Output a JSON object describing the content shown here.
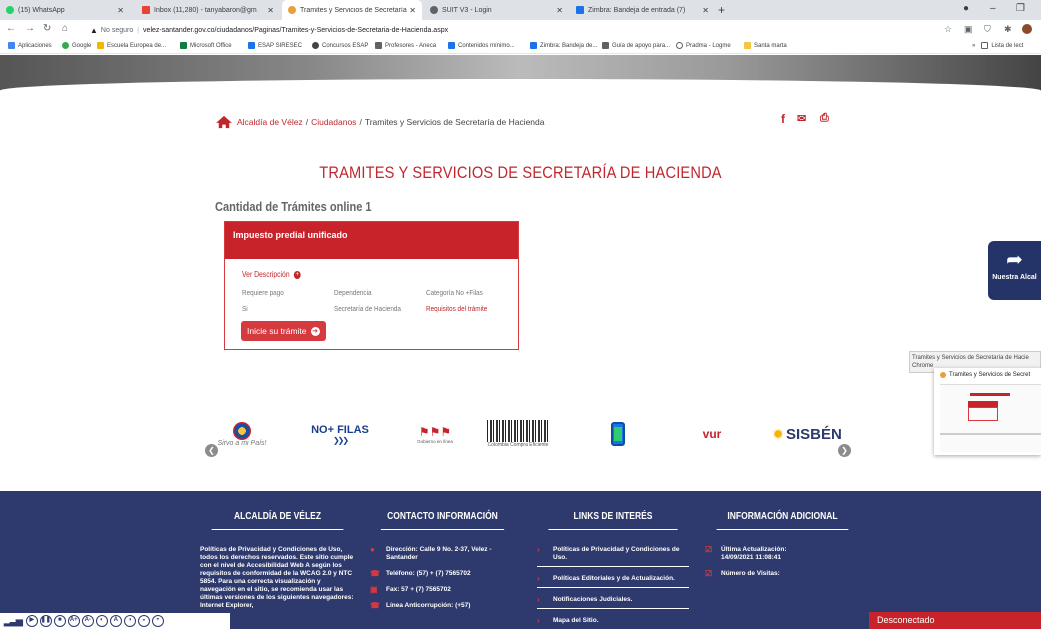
{
  "browser": {
    "tabs": [
      {
        "label": "(15) WhatsApp",
        "color": "#25d366"
      },
      {
        "label": "Inbox (11,280) - tanyabaron@gm",
        "color": "#ea4335"
      },
      {
        "label": "Tramites y Servicios de Secretaría",
        "color": "#e8a13a"
      },
      {
        "label": "SUIT V3 - Login",
        "color": "#5f6368"
      },
      {
        "label": "Zimbra: Bandeja de entrada (7)",
        "color": "#1a73e8"
      }
    ],
    "not_secure": "No seguro",
    "url": "velez-santander.gov.co/ciudadanos/Paginas/Tramites-y-Servicios-de-Secretaria-de-Hacienda.aspx",
    "bookmarks": [
      "Aplicaciones",
      "Google",
      "Escuela Europea de...",
      "Microsoft Office",
      "ESAP SIRESEC",
      "Concursos ESAP",
      "Profesores - Aneca",
      "Contenidos mínimo...",
      "Zimbra: Bandeja de...",
      "Guía de apoyo para...",
      "Pradma - Logme",
      "Santa marta"
    ],
    "reading_list": "Lista de lect"
  },
  "breadcrumb": {
    "home": "Alcaldía de Vélez",
    "sep1": "/",
    "section": "Ciudadanos",
    "sep2": "/",
    "current": "Tramites y Servicios de Secretaría de Hacienda"
  },
  "page_title": "TRAMITES Y SERVICIOS DE SECRETARÍA DE HACIENDA",
  "count_label": "Cantidad de Trámites online 1",
  "card": {
    "title": "Impuesto predial unificado",
    "desc_link": "Ver Descripción",
    "requires_label": "Requiere pago",
    "requires_value": "Si",
    "dependency_label": "Dependencia",
    "dependency_value": "Secretaría de Hacienda",
    "category_label": "Categoría No +Filas",
    "requirements_link": "Requisitos del trámite",
    "start_button": "Inicie su trámite"
  },
  "side_button": "Nuestra Alcal",
  "tooltip": {
    "line1": "Tramites y Servicios de Secretaría de Hacie",
    "line2": "Chrome"
  },
  "preview_title": "Tramites y Servicios de Secret",
  "logos": [
    {
      "label": "Sirvo a mi País!"
    },
    {
      "label": "NO+ FILAS"
    },
    {
      "label": "Gobierno en línea"
    },
    {
      "label": "Colombia Compra Eficiente"
    },
    {
      "label": ""
    },
    {
      "label": "vur"
    },
    {
      "label": "SISBÉN"
    }
  ],
  "footer": {
    "col1": {
      "title": "ALCALDÍA DE VÉLEZ",
      "text": "Políticas de Privacidad y Condiciones de Uso, todos los derechos reservados. Este sitio cumple con el nivel de Accesibilidad Web A según los requisitos de conformidad de la WCAG 2.0 y NTC 5854. Para una correcta visualización y navegación en el sitio, se recomienda usar las últimas versiones de los siguientes navegadores: Internet Explorer,"
    },
    "col2": {
      "title": "CONTACTO INFORMACIÓN",
      "items": [
        "Dirección: Calle 9 No. 2-37, Velez - Santander",
        "Teléfono: (57) + (7) 7565702",
        "Fax: 57 + (7) 7565702",
        "Línea Anticorrupción: (+57)"
      ]
    },
    "col3": {
      "title": "LINKS DE INTERÉS",
      "items": [
        "Políticas de Privacidad y Condiciones de Uso.",
        "Políticas Editoriales y de Actualización.",
        "Notificaciones Judiciales.",
        "Mapa del Sitio."
      ]
    },
    "col4": {
      "title": "INFORMACIÓN ADICIONAL",
      "updated_label": "Última Actualización:",
      "updated_value": "14/09/2021 11:08:41",
      "visits_label": "Número de Visitas:"
    }
  },
  "status": "Desconectado",
  "colors": {
    "accent": "#c0272d",
    "footer": "#2e3a6e",
    "card_header": "#c8232a"
  }
}
